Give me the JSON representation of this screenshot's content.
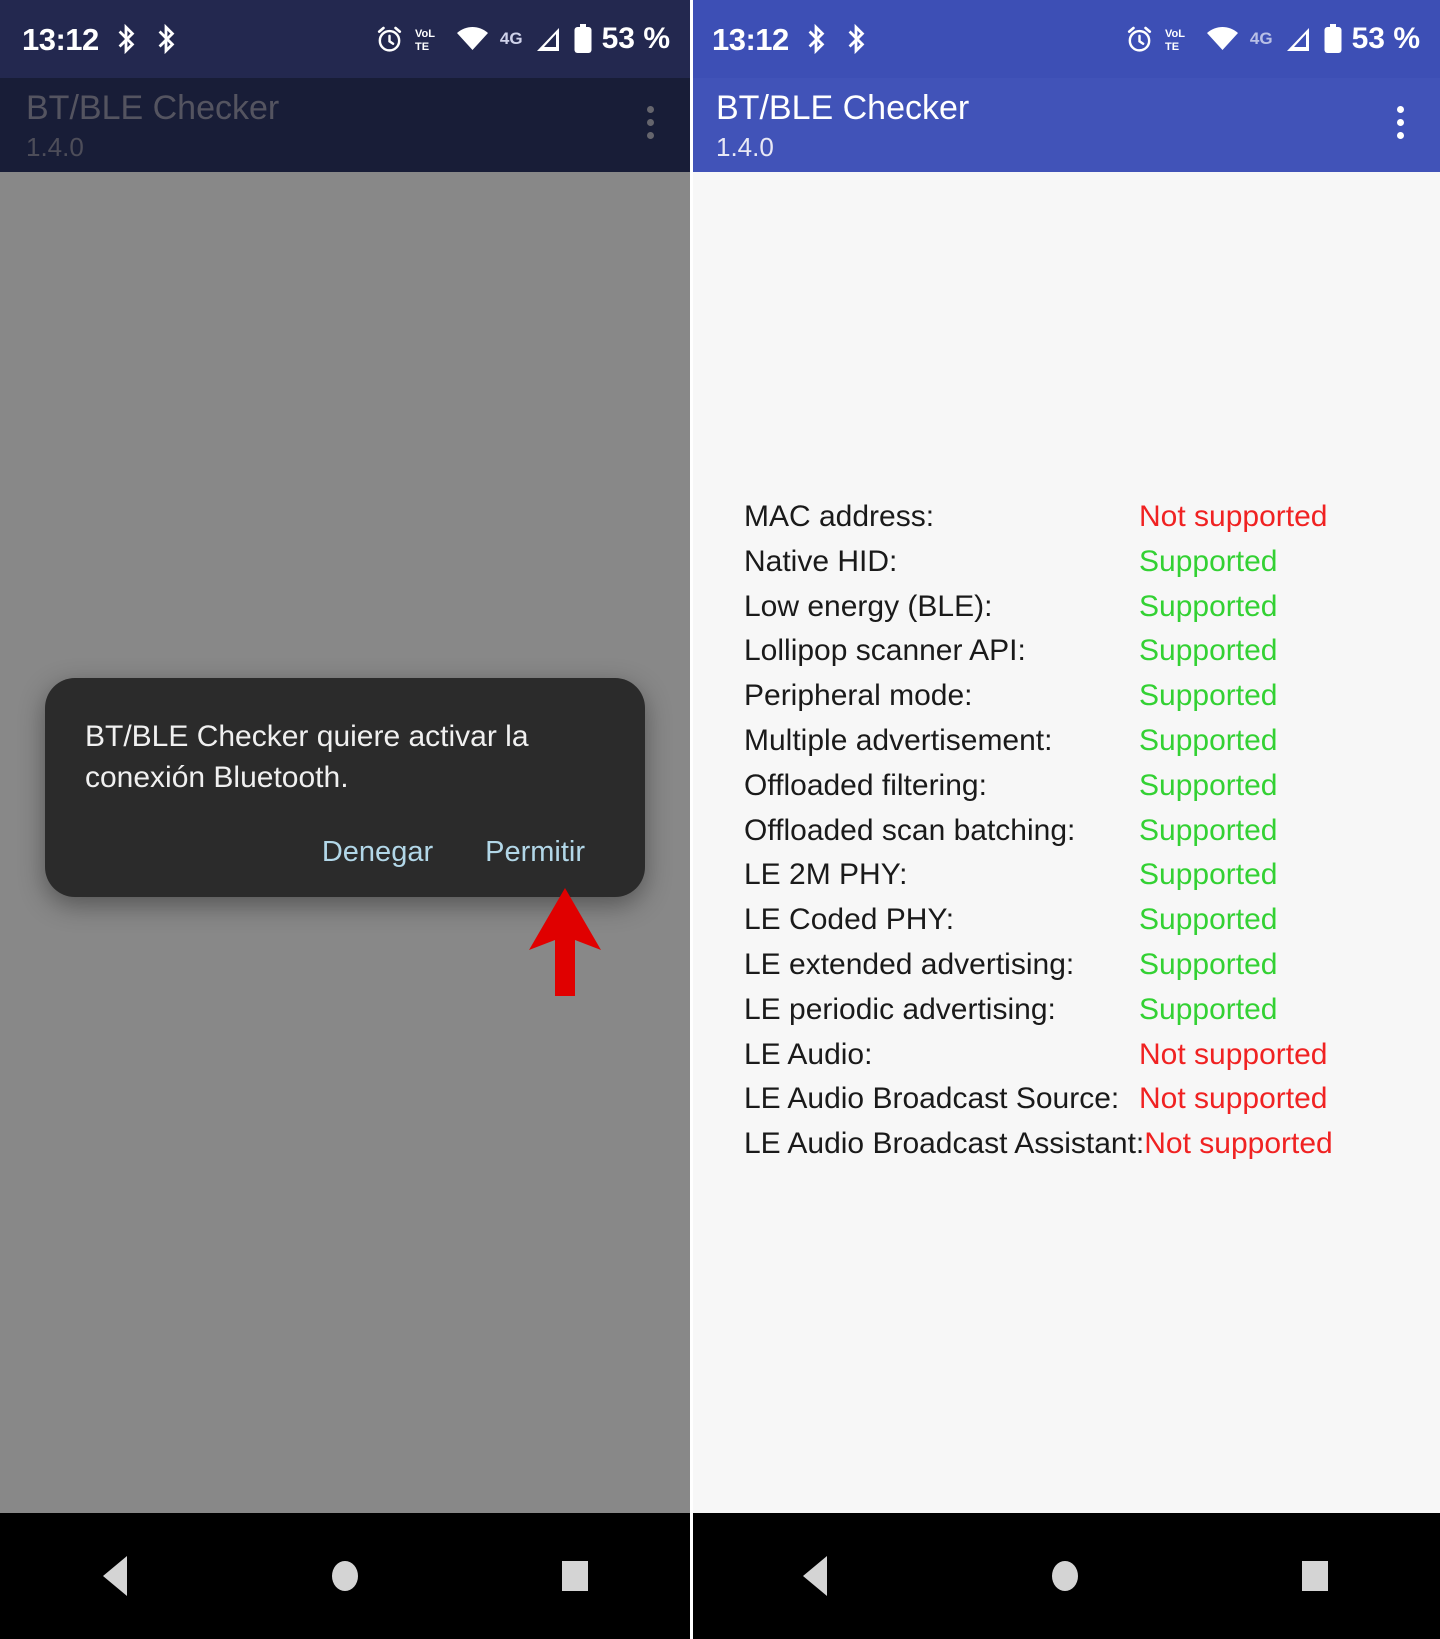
{
  "status_bar": {
    "time": "13:12",
    "battery_percent": "53 %",
    "icons": [
      "bluetooth-icon",
      "bluetooth-icon",
      "alarm-icon",
      "volte-icon",
      "wifi-icon",
      "network-4g-icon",
      "signal-icon",
      "battery-icon"
    ],
    "network_label": "4G",
    "volte_label": "VoLTE"
  },
  "app_bar": {
    "title": "BT/BLE Checker",
    "version": "1.4.0",
    "overflow_menu": "more-options"
  },
  "dialog": {
    "message": "BT/BLE Checker quiere activar la conexión Bluetooth.",
    "deny_label": "Denegar",
    "allow_label": "Permitir"
  },
  "annotation": {
    "arrow": "red-up-arrow",
    "arrow_color": "#e00000",
    "points_at": "Permitir"
  },
  "navigation_bar": {
    "back": "back-button",
    "home": "home-button",
    "recents": "recents-button"
  },
  "colors": {
    "app_bar": "#4153b8",
    "status_bar": "#3d4fb5",
    "supported": "#33d133",
    "not_supported": "#f02222",
    "dialog_bg": "#2b2b2b",
    "dialog_action": "#b2d7e8"
  },
  "features": [
    {
      "label": "MAC address:",
      "value": "Not supported",
      "state": "no"
    },
    {
      "label": "Native HID:",
      "value": "Supported",
      "state": "ok"
    },
    {
      "label": "Low energy (BLE):",
      "value": "Supported",
      "state": "ok"
    },
    {
      "label": "Lollipop scanner API:",
      "value": "Supported",
      "state": "ok"
    },
    {
      "label": "Peripheral mode:",
      "value": "Supported",
      "state": "ok"
    },
    {
      "label": "Multiple advertisement:",
      "value": "Supported",
      "state": "ok"
    },
    {
      "label": "Offloaded filtering:",
      "value": "Supported",
      "state": "ok"
    },
    {
      "label": "Offloaded scan batching:",
      "value": "Supported",
      "state": "ok"
    },
    {
      "label": "LE 2M PHY:",
      "value": "Supported",
      "state": "ok"
    },
    {
      "label": "LE Coded PHY:",
      "value": "Supported",
      "state": "ok"
    },
    {
      "label": "LE extended advertising:",
      "value": "Supported",
      "state": "ok"
    },
    {
      "label": "LE periodic advertising:",
      "value": "Supported",
      "state": "ok"
    },
    {
      "label": "LE Audio:",
      "value": "Not supported",
      "state": "no"
    },
    {
      "label": "LE Audio Broadcast Source:",
      "value": "Not supported",
      "state": "no"
    },
    {
      "label": "LE Audio Broadcast Assistant:",
      "value": "Not supported",
      "state": "no"
    }
  ]
}
